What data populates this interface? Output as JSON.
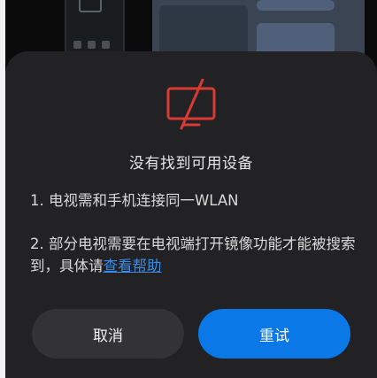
{
  "dialog": {
    "title": "没有找到可用设备",
    "tip1": "1. 电视需和手机连接同一WLAN",
    "tip2_prefix": "2. 部分电视需要在电视端打开镜像功能才能被搜索到，具体请",
    "help_link": "查看帮助",
    "cancel_label": "取消",
    "retry_label": "重试",
    "icon": "tv-off-icon"
  },
  "colors": {
    "sheet_bg": "#222224",
    "accent": "#0a78e6",
    "link": "#3c8be6",
    "icon_red": "#d83a34"
  }
}
